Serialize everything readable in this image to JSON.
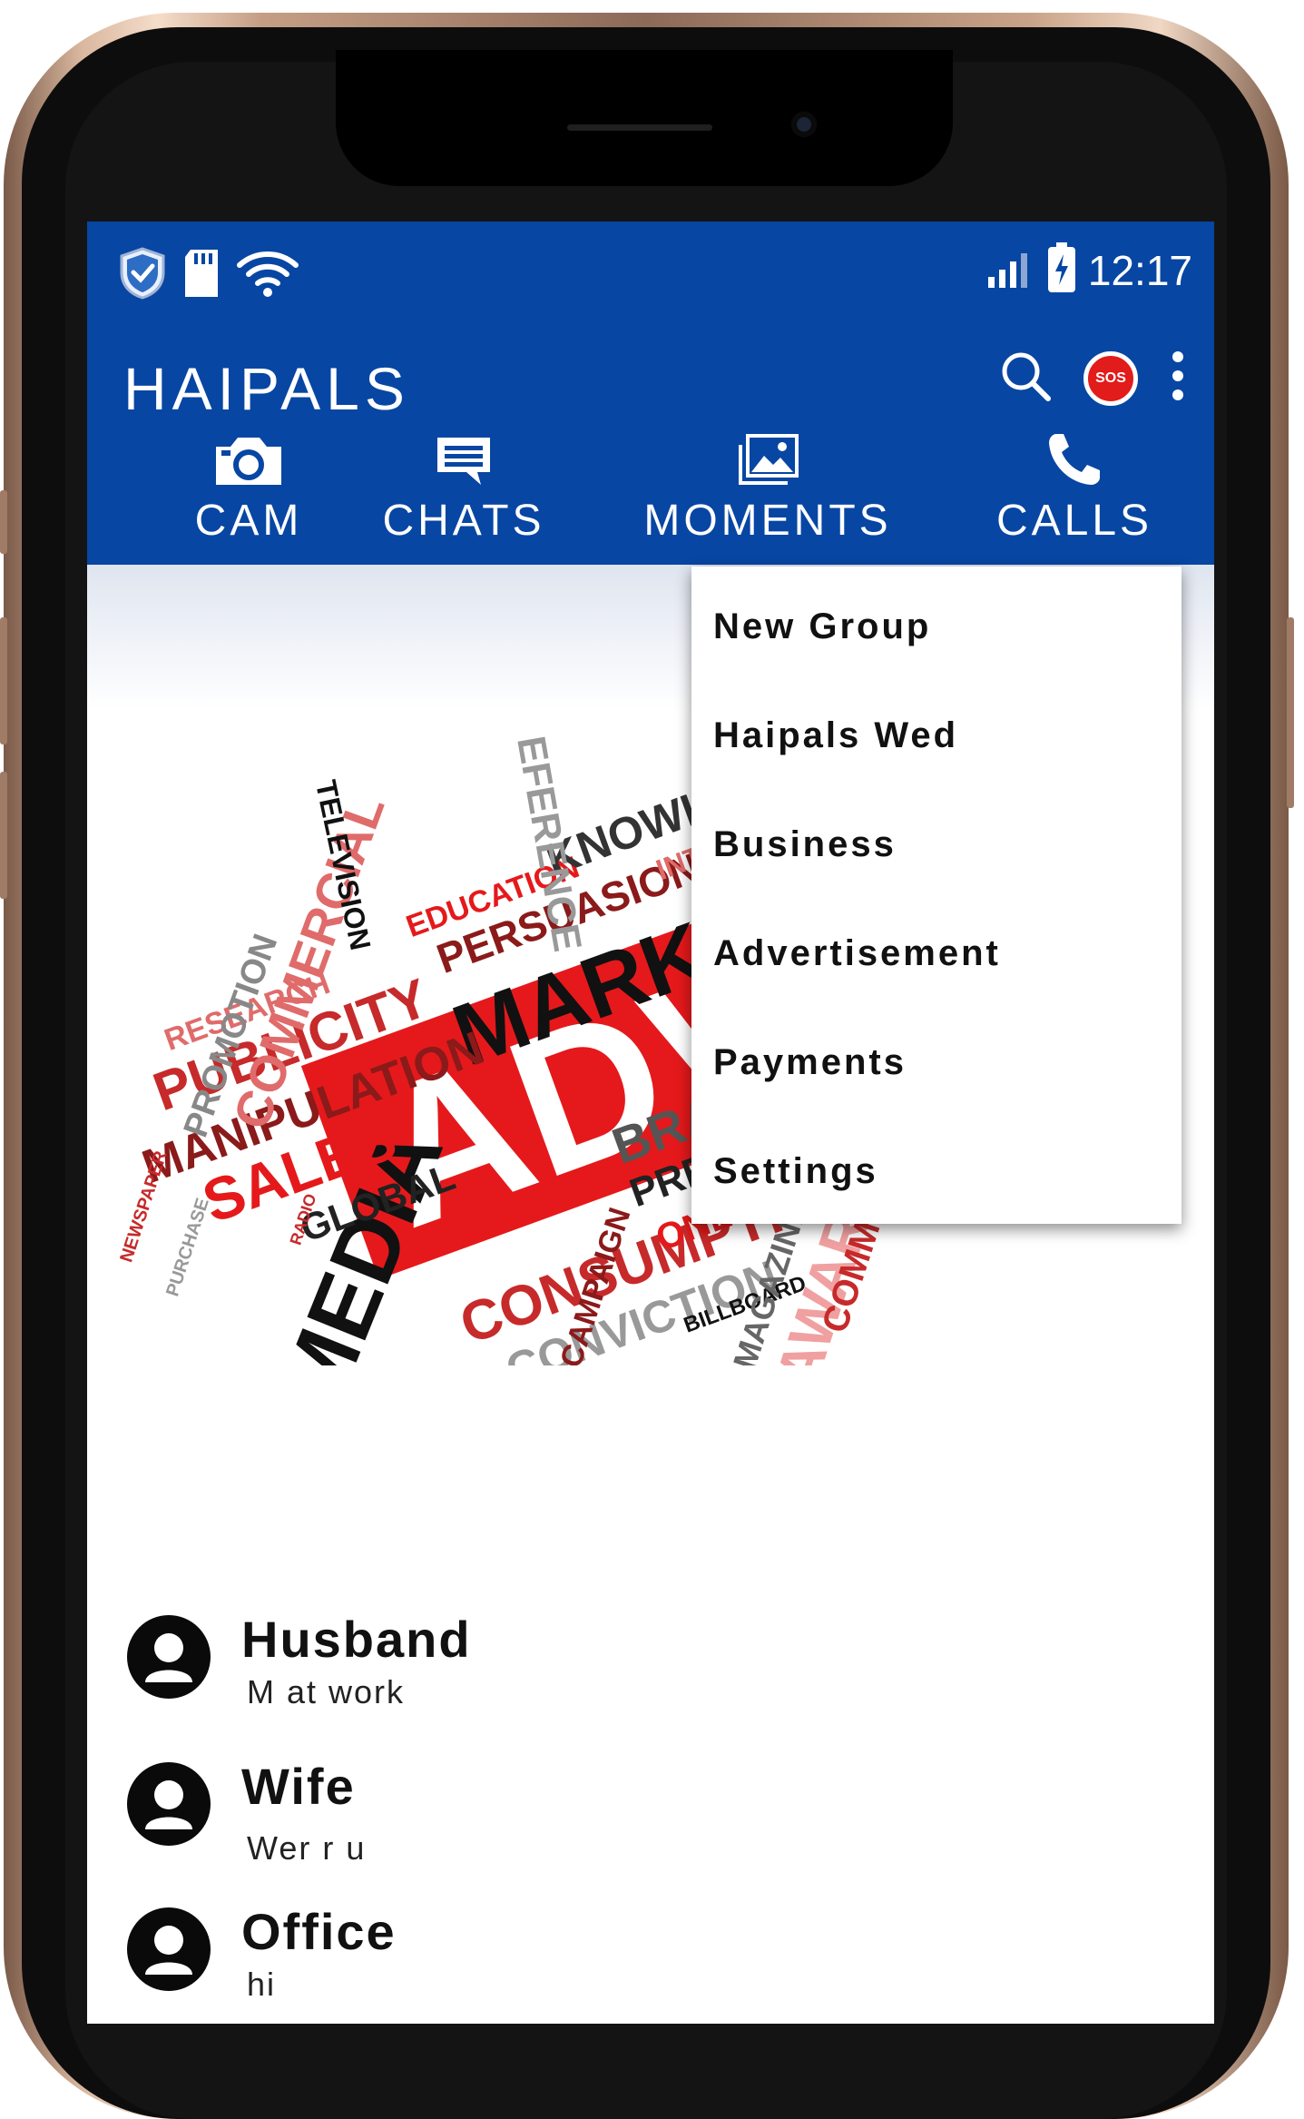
{
  "status_bar": {
    "time": "12:17",
    "icons": [
      "shield-check-icon",
      "sd-card-icon",
      "wifi-icon",
      "signal-icon",
      "battery-charging-icon"
    ]
  },
  "app": {
    "title": "HAIPALS",
    "accent_color": "#0746a3",
    "sos_label": "SOS"
  },
  "tabs": [
    {
      "label": "CAM",
      "icon": "camera-icon"
    },
    {
      "label": "CHATS",
      "icon": "chat-icon"
    },
    {
      "label": "MOMENTS",
      "icon": "gallery-icon"
    },
    {
      "label": "CALLS",
      "icon": "phone-icon"
    }
  ],
  "overflow_menu": [
    {
      "label": "New Group"
    },
    {
      "label": "Haipals Wed"
    },
    {
      "label": "Business"
    },
    {
      "label": "Advertisement"
    },
    {
      "label": "Payments"
    },
    {
      "label": "Settings"
    }
  ],
  "banner": {
    "words": {
      "main": "ADVER",
      "marketing": "MARKETING",
      "media": "MEDIA",
      "consumption": "CONSUMPTION",
      "publicity": "PUBLICITY",
      "manipulation": "MANIPULATION",
      "sales": "SALES",
      "global": "GLOBAL",
      "commercial": "COMMERCIAL",
      "promotion": "PROMOTION",
      "research": "RESEARCH",
      "knowledge": "KNOWLEDGE",
      "education": "EDUCATION",
      "persuasion": "PERSUASION",
      "interest": "INTEREST",
      "television": "TELEVISION",
      "reference": "EFERENCE",
      "conviction": "CONVICTION",
      "billboard": "BILLBOARD",
      "campaign": "CAMPAIGN",
      "press": "PRESS",
      "bra": "BRA",
      "online": "ONLINE",
      "magazine": "MAGAZINE",
      "awareness": "AWARENESS",
      "communication": "COMMUNICATI",
      "newspaper": "NEWSPAPER",
      "purchase": "PURCHASE",
      "radio": "RADIO"
    }
  },
  "contacts": [
    {
      "name": "Husband",
      "message": "M at work"
    },
    {
      "name": "Wife",
      "message": "Wer r u"
    },
    {
      "name": "Office",
      "message": "hi"
    }
  ]
}
